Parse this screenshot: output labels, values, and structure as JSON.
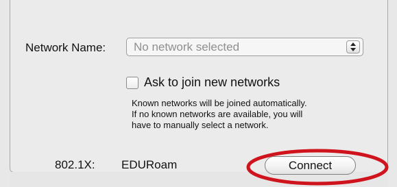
{
  "network": {
    "label": "Network Name:",
    "selected_value": "No network selected"
  },
  "ask_to_join": {
    "label": "Ask to join new networks",
    "checked": false,
    "help_lines": [
      "Known networks will be joined automatically.",
      "If no known networks are available, you will",
      "have to manually select a network."
    ]
  },
  "dot1x": {
    "label": "802.1X:",
    "value": "EDURoam"
  },
  "connect_button": {
    "label": "Connect"
  },
  "colors": {
    "annotation_ellipse": "#d0141e",
    "panel_bg": "#ebebeb"
  },
  "icons": {
    "select_arrows": "up-down-arrows-icon"
  }
}
